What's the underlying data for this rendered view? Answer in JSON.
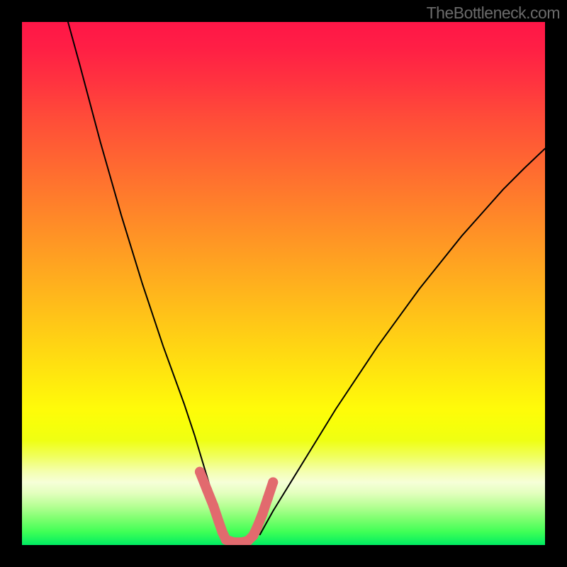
{
  "attribution": "TheBottleneck.com",
  "chart_data": {
    "type": "line",
    "title": "",
    "xlabel": "",
    "ylabel": "",
    "xlim": [
      0,
      100
    ],
    "ylim": [
      0,
      100
    ],
    "grid": false,
    "legend": false,
    "background_gradient": {
      "top": "#ff1647",
      "mid": "#fffb09",
      "bottom": "#00ec62"
    },
    "series": [
      {
        "name": "black-curve-left",
        "color": "#000000",
        "width": 2,
        "x": [
          8.8,
          11.0,
          13.0,
          15.0,
          17.0,
          19.0,
          21.0,
          23.0,
          25.0,
          27.0,
          29.0,
          31.0,
          33.0,
          34.5,
          36.0,
          37.0,
          37.8
        ],
        "y": [
          100.0,
          92.0,
          84.5,
          77.0,
          70.0,
          63.0,
          56.5,
          50.0,
          44.0,
          38.0,
          32.5,
          27.0,
          21.0,
          16.0,
          11.0,
          6.0,
          2.0
        ]
      },
      {
        "name": "black-curve-right",
        "color": "#000000",
        "width": 2,
        "x": [
          45.5,
          48.0,
          52.0,
          56.0,
          60.0,
          64.0,
          68.0,
          72.0,
          76.0,
          80.0,
          84.0,
          88.0,
          92.0,
          96.0,
          100.0
        ],
        "y": [
          2.0,
          6.5,
          13.0,
          19.5,
          26.0,
          32.0,
          38.0,
          43.5,
          49.0,
          54.0,
          59.0,
          63.5,
          68.0,
          72.0,
          75.8
        ]
      },
      {
        "name": "pink-valley",
        "color": "#e26a6e",
        "width": 14,
        "style": "dashed-capsule",
        "x": [
          34.0,
          35.4,
          36.6,
          37.6,
          38.3,
          39.0,
          40.5,
          42.0,
          43.2,
          44.2,
          45.0,
          46.0,
          47.0,
          48.0
        ],
        "y": [
          14.0,
          10.5,
          7.5,
          4.5,
          2.5,
          1.0,
          0.5,
          0.5,
          0.8,
          1.8,
          3.5,
          6.0,
          9.0,
          12.0
        ]
      }
    ],
    "notes": "Axes unlabeled; values are estimates in percent of plot area. y=0 is bottom (green), y=100 is top (red)."
  }
}
